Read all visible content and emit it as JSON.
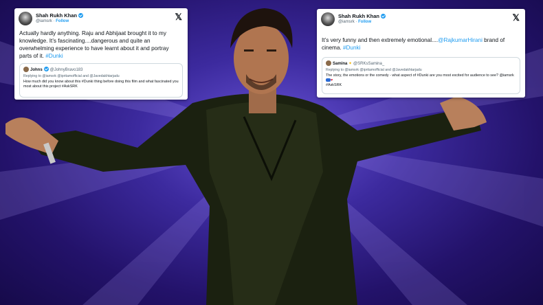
{
  "colors": {
    "twitter_blue": "#1d9bf0",
    "background": "#3c2a9e",
    "card": "#ffffff"
  },
  "left_tweet": {
    "author": "Shah Rukh Khan",
    "handle": "@iamsrk",
    "separator": "·",
    "follow_label": "Follow",
    "close_icon": "x-logo-icon",
    "text": "Actually hardly anything. Raju and Abhijaat brought it to my knowledge. It’s fascinating....dangerous and quite an overwhelming experience to have learnt about it and portray parts of it.",
    "hashtag": "#Dunki",
    "quote": {
      "author": "Johns",
      "handle": "@JohnyBravo183",
      "replying_to": "Replying to @iamsrk @ipritamofficial and @Javedakhtarjadu",
      "text": "How much did you know about this #Dunki thing before doing this film and what fascinated you most about this project #AskSRK"
    }
  },
  "right_tweet": {
    "author": "Shah Rukh Khan",
    "handle": "@iamsrk",
    "separator": "·",
    "follow_label": "Follow",
    "close_icon": "x-logo-icon",
    "text": "It’s very funny and then extremely emotional....",
    "mention": "@RajkumarHirani",
    "text_after": " brand of cinema.",
    "hashtag": "#Dunki",
    "quote": {
      "author": "Samina",
      "handle": "@SRKsSamina_",
      "replying_to": "Replying to @iamsrk @ipritamofficial and @Javedakhtarjadu",
      "text": "The story, the emotions or the comedy - what aspect of #Dunki  are you most excited for audience to see? @iamsrk",
      "tag": "#AskSRK"
    }
  }
}
